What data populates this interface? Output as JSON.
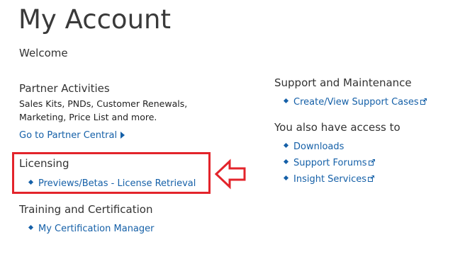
{
  "page": {
    "title": "My Account",
    "welcome": "Welcome"
  },
  "partner": {
    "heading": "Partner Activities",
    "desc_line1": "Sales Kits, PNDs, Customer Renewals,",
    "desc_line2": "Marketing, Price List and more.",
    "link": "Go to Partner Central",
    "link_icon": "arrow-right-icon"
  },
  "licensing": {
    "heading": "Licensing",
    "link": "Previews/Betas - License Retrieval"
  },
  "training": {
    "heading": "Training and Certification",
    "link": "My Certification Manager"
  },
  "support": {
    "heading": "Support and Maintenance",
    "link": "Create/View Support Cases",
    "link_icon": "external-link-icon"
  },
  "access": {
    "heading": "You also have access to",
    "items": [
      {
        "label": "Downloads",
        "external": false
      },
      {
        "label": "Support Forums",
        "external": true
      },
      {
        "label": "Insight Services",
        "external": true
      }
    ]
  },
  "colors": {
    "link": "#1560a8",
    "text": "#333333",
    "annotation": "#e3242b",
    "background": "#ffffff"
  }
}
